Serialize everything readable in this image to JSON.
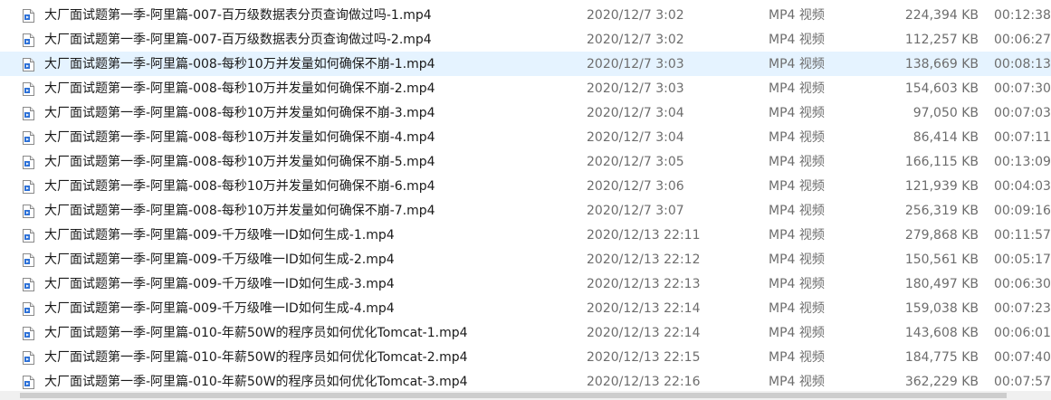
{
  "files": [
    {
      "name": "大厂面试题第一季-阿里篇-007-百万级数据表分页查询做过吗-1.mp4",
      "date": "2020/12/7 3:02",
      "type": "MP4 视频",
      "size": "224,394 KB",
      "duration": "00:12:38",
      "selected": false
    },
    {
      "name": "大厂面试题第一季-阿里篇-007-百万级数据表分页查询做过吗-2.mp4",
      "date": "2020/12/7 3:02",
      "type": "MP4 视频",
      "size": "112,257 KB",
      "duration": "00:06:27",
      "selected": false
    },
    {
      "name": "大厂面试题第一季-阿里篇-008-每秒10万并发量如何确保不崩-1.mp4",
      "date": "2020/12/7 3:03",
      "type": "MP4 视频",
      "size": "138,669 KB",
      "duration": "00:08:13",
      "selected": true
    },
    {
      "name": "大厂面试题第一季-阿里篇-008-每秒10万并发量如何确保不崩-2.mp4",
      "date": "2020/12/7 3:03",
      "type": "MP4 视频",
      "size": "154,603 KB",
      "duration": "00:07:30",
      "selected": false
    },
    {
      "name": "大厂面试题第一季-阿里篇-008-每秒10万并发量如何确保不崩-3.mp4",
      "date": "2020/12/7 3:04",
      "type": "MP4 视频",
      "size": "97,050 KB",
      "duration": "00:07:03",
      "selected": false
    },
    {
      "name": "大厂面试题第一季-阿里篇-008-每秒10万并发量如何确保不崩-4.mp4",
      "date": "2020/12/7 3:04",
      "type": "MP4 视频",
      "size": "86,414 KB",
      "duration": "00:07:11",
      "selected": false
    },
    {
      "name": "大厂面试题第一季-阿里篇-008-每秒10万并发量如何确保不崩-5.mp4",
      "date": "2020/12/7 3:05",
      "type": "MP4 视频",
      "size": "166,115 KB",
      "duration": "00:13:09",
      "selected": false
    },
    {
      "name": "大厂面试题第一季-阿里篇-008-每秒10万并发量如何确保不崩-6.mp4",
      "date": "2020/12/7 3:06",
      "type": "MP4 视频",
      "size": "121,939 KB",
      "duration": "00:04:03",
      "selected": false
    },
    {
      "name": "大厂面试题第一季-阿里篇-008-每秒10万并发量如何确保不崩-7.mp4",
      "date": "2020/12/7 3:07",
      "type": "MP4 视频",
      "size": "256,319 KB",
      "duration": "00:09:16",
      "selected": false
    },
    {
      "name": "大厂面试题第一季-阿里篇-009-千万级唯一ID如何生成-1.mp4",
      "date": "2020/12/13 22:11",
      "type": "MP4 视频",
      "size": "279,868 KB",
      "duration": "00:11:57",
      "selected": false
    },
    {
      "name": "大厂面试题第一季-阿里篇-009-千万级唯一ID如何生成-2.mp4",
      "date": "2020/12/13 22:12",
      "type": "MP4 视频",
      "size": "150,561 KB",
      "duration": "00:05:17",
      "selected": false
    },
    {
      "name": "大厂面试题第一季-阿里篇-009-千万级唯一ID如何生成-3.mp4",
      "date": "2020/12/13 22:13",
      "type": "MP4 视频",
      "size": "180,497 KB",
      "duration": "00:06:30",
      "selected": false
    },
    {
      "name": "大厂面试题第一季-阿里篇-009-千万级唯一ID如何生成-4.mp4",
      "date": "2020/12/13 22:14",
      "type": "MP4 视频",
      "size": "159,038 KB",
      "duration": "00:07:23",
      "selected": false
    },
    {
      "name": "大厂面试题第一季-阿里篇-010-年薪50W的程序员如何优化Tomcat-1.mp4",
      "date": "2020/12/13 22:14",
      "type": "MP4 视频",
      "size": "143,608 KB",
      "duration": "00:06:01",
      "selected": false
    },
    {
      "name": "大厂面试题第一季-阿里篇-010-年薪50W的程序员如何优化Tomcat-2.mp4",
      "date": "2020/12/13 22:15",
      "type": "MP4 视频",
      "size": "184,775 KB",
      "duration": "00:07:40",
      "selected": false
    },
    {
      "name": "大厂面试题第一季-阿里篇-010-年薪50W的程序员如何优化Tomcat-3.mp4",
      "date": "2020/12/13 22:16",
      "type": "MP4 视频",
      "size": "362,229 KB",
      "duration": "00:07:57",
      "selected": false
    }
  ],
  "icons": {
    "file": "video-file-icon"
  },
  "colors": {
    "selected_row": "#e5f3ff",
    "primary_text": "#1a1a1a",
    "secondary_text": "#6d6d6d",
    "icon_accent": "#2b6fd6"
  }
}
